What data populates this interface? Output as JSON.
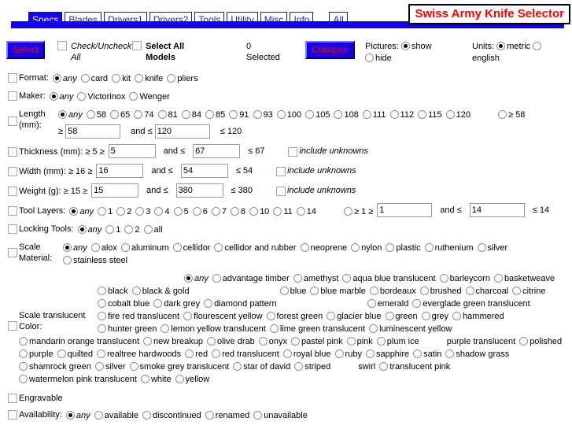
{
  "header": {
    "title": "Swiss Army Knife Selector",
    "title_color": "#ff0000",
    "tabs": [
      {
        "label": "Specs",
        "active": true
      },
      {
        "label": "Blades",
        "active": false
      },
      {
        "label": "Drivers1",
        "active": false
      },
      {
        "label": "Drivers2",
        "active": false
      },
      {
        "label": "Tools",
        "active": false
      },
      {
        "label": "Utility",
        "active": false
      },
      {
        "label": "Misc",
        "active": false
      },
      {
        "label": "Info",
        "active": false
      },
      {
        "label": "All",
        "active": false
      }
    ],
    "accent_color": "#1400ec"
  },
  "toolbar": {
    "select_button": "Select",
    "check_uncheck_label": "Check/Uncheck All",
    "select_all_models_label": "Select All Models",
    "selected_count": "0",
    "selected_word": "Selected",
    "collapse_button": "Collapse",
    "pictures_label": "Pictures:",
    "pictures_show": "show",
    "pictures_hide": "hide",
    "units_label": "Units:",
    "units_metric": "metric",
    "units_english": "english"
  },
  "criteria": {
    "format": {
      "label": "Format:",
      "options": [
        "any",
        "card",
        "kit",
        "knife",
        "pliers"
      ],
      "selected": "any"
    },
    "maker": {
      "label": "Maker:",
      "options": [
        "any",
        "Victorinox",
        "Wenger"
      ],
      "selected": "any"
    },
    "length": {
      "label_line1": "Length",
      "label_line2": "(mm):",
      "options": [
        "any",
        "58",
        "65",
        "74",
        "81",
        "84",
        "85",
        "91",
        "93",
        "100",
        "105",
        "108",
        "111",
        "112",
        "115",
        "120"
      ],
      "selected": "any",
      "range_option": "≥ 58",
      "min_prefix": "≥",
      "min_value": "58",
      "mid_label": "and ≤",
      "max_value": "120",
      "max_suffix": "≤ 120"
    },
    "thickness": {
      "label": "Thickness (mm): ≥ 5 ≥",
      "min_value": "5",
      "mid_label": "and ≤",
      "max_value": "67",
      "max_suffix": "≤ 67",
      "include_unknowns": "include unknowns"
    },
    "width": {
      "label": "Width (mm): ≥ 16 ≥",
      "min_value": "16",
      "mid_label": "and ≤",
      "max_value": "54",
      "max_suffix": "≤ 54",
      "include_unknowns": "include unknowns"
    },
    "weight": {
      "label": "Weight (g): ≥ 15 ≥",
      "min_value": "15",
      "mid_label": "and ≤",
      "max_value": "380",
      "max_suffix": "≤ 380",
      "include_unknowns": "include unknowns"
    },
    "tool_layers": {
      "label": "Tool Layers:",
      "options": [
        "any",
        "1",
        "2",
        "3",
        "4",
        "5",
        "6",
        "7",
        "8",
        "10",
        "11",
        "14"
      ],
      "selected": "any",
      "range_option": "≥ 1 ≥",
      "min_value": "1",
      "mid_label": "and ≤",
      "max_value": "14",
      "max_suffix": "≤ 14"
    },
    "locking_tools": {
      "label": "Locking Tools:",
      "options": [
        "any",
        "1",
        "2",
        "all"
      ],
      "selected": "any"
    },
    "scale_material": {
      "label_line1": "Scale",
      "label_line2": "Material:",
      "options": [
        "any",
        "alox",
        "aluminum",
        "cellidor",
        "cellidor and rubber",
        "neoprene",
        "nylon",
        "plastic",
        "ruthenium",
        "silver",
        "stainless steel"
      ],
      "selected": "any"
    },
    "scale_color": {
      "label_line1": "Scale translucent",
      "label_line2": "Color:",
      "options": [
        "any",
        "advantage timber",
        "amethyst",
        "aqua blue translucent",
        "barleycorn",
        "basketweave",
        "black",
        "black & gold",
        "blue",
        "blue marble",
        "bordeaux",
        "brushed",
        "charcoal",
        "citrine",
        "cobalt blue",
        "dark grey",
        "diamond pattern",
        "emerald",
        "everglade green translucent",
        "fire red translucent",
        "flourescent yellow",
        "forest green",
        "glacier blue",
        "green",
        "grey",
        "hammered",
        "hunter green",
        "lemon yellow translucent",
        "lime green translucent",
        "luminescent yellow",
        "mandarin orange translucent",
        "new breakup",
        "olive drab",
        "onyx",
        "pastel pink",
        "pink",
        "plum ice",
        "purple translucent",
        "polished",
        "purple",
        "quilted",
        "realtree hardwoods",
        "red",
        "red translucent",
        "royal blue",
        "ruby",
        "sapphire",
        "satin",
        "shadow grass",
        "shamrock green",
        "silver",
        "smoke grey translucent",
        "star of david",
        "striped",
        "swirl",
        "translucent pink",
        "watermelon pink translucent",
        "white",
        "yellow"
      ],
      "selected": "any"
    },
    "engravable": {
      "label": "Engravable"
    },
    "availability": {
      "label": "Availability:",
      "options": [
        "any",
        "available",
        "discontinued",
        "renamed",
        "unavailable"
      ],
      "selected": "any"
    }
  }
}
